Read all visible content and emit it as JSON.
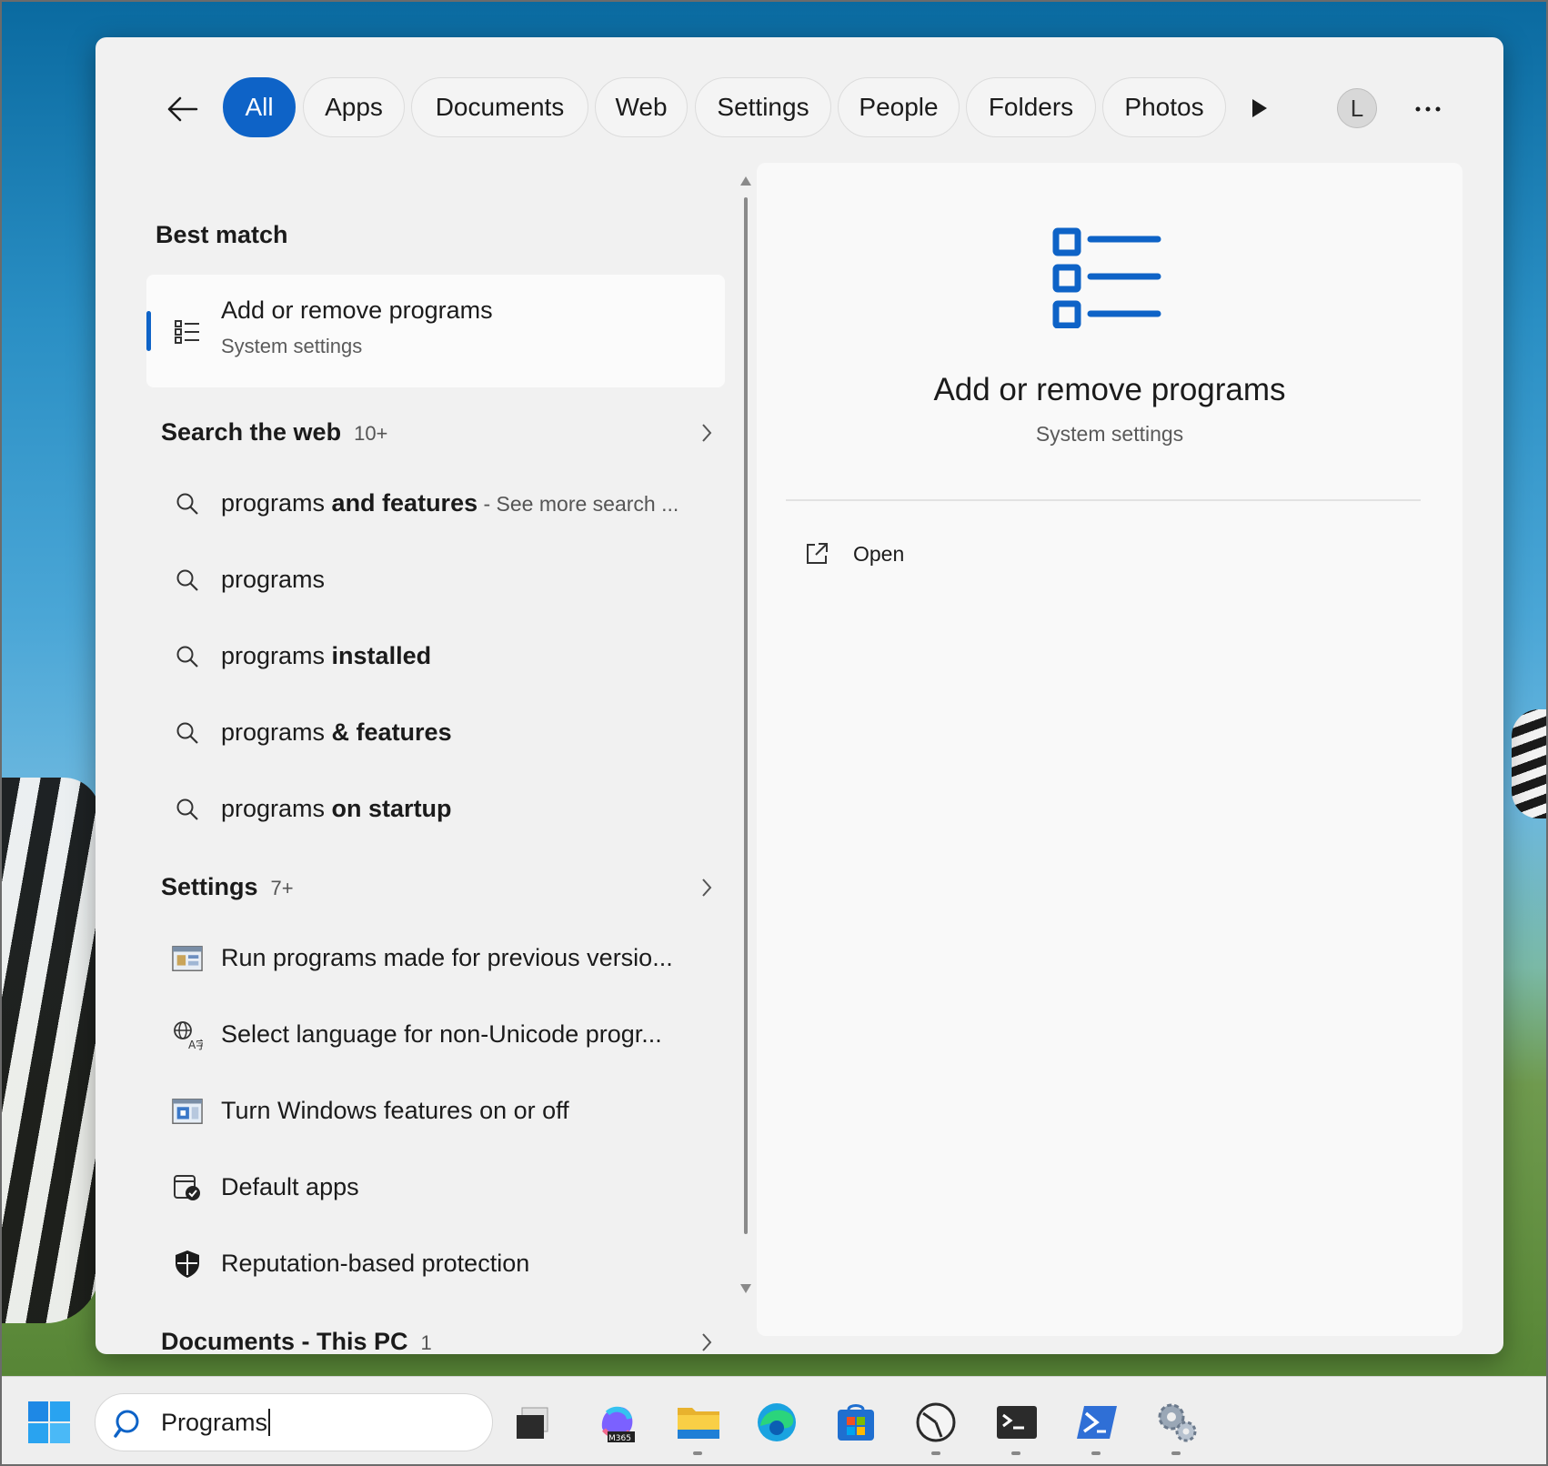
{
  "filter_tabs": [
    "All",
    "Apps",
    "Documents",
    "Web",
    "Settings",
    "People",
    "Folders",
    "Photos"
  ],
  "active_tab": "All",
  "avatar_initial": "L",
  "best_match": {
    "heading": "Best match",
    "title": "Add or remove programs",
    "subtitle": "System settings"
  },
  "web_section": {
    "heading": "Search the web",
    "count": "10+",
    "items": [
      {
        "plain": "programs ",
        "bold": "and features",
        "muted": " - See more search ..."
      },
      {
        "plain": "programs",
        "bold": "",
        "muted": ""
      },
      {
        "plain": "programs ",
        "bold": "installed",
        "muted": ""
      },
      {
        "plain": "programs ",
        "bold": "& features",
        "muted": ""
      },
      {
        "plain": "programs ",
        "bold": "on startup",
        "muted": ""
      }
    ]
  },
  "settings_section": {
    "heading": "Settings",
    "count": "7+",
    "items": [
      {
        "label": "Run programs made for previous versio...",
        "icon": "compatibility-icon"
      },
      {
        "label": "Select language for non-Unicode progr...",
        "icon": "language-icon"
      },
      {
        "label": "Turn Windows features on or off",
        "icon": "windows-features-icon"
      },
      {
        "label": "Default apps",
        "icon": "default-apps-icon"
      },
      {
        "label": "Reputation-based protection",
        "icon": "shield-icon"
      }
    ]
  },
  "documents_section": {
    "heading": "Documents - This PC",
    "count": "1"
  },
  "preview": {
    "title": "Add or remove programs",
    "subtitle": "System settings",
    "open_label": "Open"
  },
  "taskbar": {
    "search_value": "Programs",
    "apps": [
      "task-view-icon",
      "m365-copilot-icon",
      "file-explorer-icon",
      "edge-icon",
      "store-icon",
      "clock-app-icon",
      "terminal-icon",
      "powershell-icon",
      "settings-gear-icon"
    ]
  },
  "colors": {
    "accent": "#0e63c7",
    "panel_bg": "#f1f1f1",
    "preview_bg": "#f9f9f9"
  }
}
